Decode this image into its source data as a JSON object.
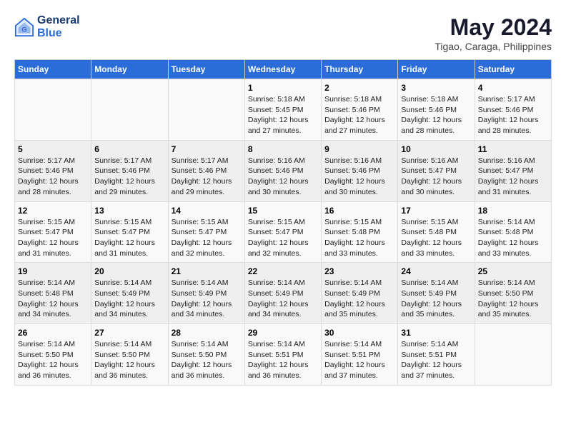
{
  "header": {
    "logo_line1": "General",
    "logo_line2": "Blue",
    "title": "May 2024",
    "subtitle": "Tigao, Caraga, Philippines"
  },
  "calendar": {
    "weekdays": [
      "Sunday",
      "Monday",
      "Tuesday",
      "Wednesday",
      "Thursday",
      "Friday",
      "Saturday"
    ],
    "weeks": [
      [
        {
          "day": "",
          "info": ""
        },
        {
          "day": "",
          "info": ""
        },
        {
          "day": "",
          "info": ""
        },
        {
          "day": "1",
          "info": "Sunrise: 5:18 AM\nSunset: 5:45 PM\nDaylight: 12 hours\nand 27 minutes."
        },
        {
          "day": "2",
          "info": "Sunrise: 5:18 AM\nSunset: 5:46 PM\nDaylight: 12 hours\nand 27 minutes."
        },
        {
          "day": "3",
          "info": "Sunrise: 5:18 AM\nSunset: 5:46 PM\nDaylight: 12 hours\nand 28 minutes."
        },
        {
          "day": "4",
          "info": "Sunrise: 5:17 AM\nSunset: 5:46 PM\nDaylight: 12 hours\nand 28 minutes."
        }
      ],
      [
        {
          "day": "5",
          "info": "Sunrise: 5:17 AM\nSunset: 5:46 PM\nDaylight: 12 hours\nand 28 minutes."
        },
        {
          "day": "6",
          "info": "Sunrise: 5:17 AM\nSunset: 5:46 PM\nDaylight: 12 hours\nand 29 minutes."
        },
        {
          "day": "7",
          "info": "Sunrise: 5:17 AM\nSunset: 5:46 PM\nDaylight: 12 hours\nand 29 minutes."
        },
        {
          "day": "8",
          "info": "Sunrise: 5:16 AM\nSunset: 5:46 PM\nDaylight: 12 hours\nand 30 minutes."
        },
        {
          "day": "9",
          "info": "Sunrise: 5:16 AM\nSunset: 5:46 PM\nDaylight: 12 hours\nand 30 minutes."
        },
        {
          "day": "10",
          "info": "Sunrise: 5:16 AM\nSunset: 5:47 PM\nDaylight: 12 hours\nand 30 minutes."
        },
        {
          "day": "11",
          "info": "Sunrise: 5:16 AM\nSunset: 5:47 PM\nDaylight: 12 hours\nand 31 minutes."
        }
      ],
      [
        {
          "day": "12",
          "info": "Sunrise: 5:15 AM\nSunset: 5:47 PM\nDaylight: 12 hours\nand 31 minutes."
        },
        {
          "day": "13",
          "info": "Sunrise: 5:15 AM\nSunset: 5:47 PM\nDaylight: 12 hours\nand 31 minutes."
        },
        {
          "day": "14",
          "info": "Sunrise: 5:15 AM\nSunset: 5:47 PM\nDaylight: 12 hours\nand 32 minutes."
        },
        {
          "day": "15",
          "info": "Sunrise: 5:15 AM\nSunset: 5:47 PM\nDaylight: 12 hours\nand 32 minutes."
        },
        {
          "day": "16",
          "info": "Sunrise: 5:15 AM\nSunset: 5:48 PM\nDaylight: 12 hours\nand 33 minutes."
        },
        {
          "day": "17",
          "info": "Sunrise: 5:15 AM\nSunset: 5:48 PM\nDaylight: 12 hours\nand 33 minutes."
        },
        {
          "day": "18",
          "info": "Sunrise: 5:14 AM\nSunset: 5:48 PM\nDaylight: 12 hours\nand 33 minutes."
        }
      ],
      [
        {
          "day": "19",
          "info": "Sunrise: 5:14 AM\nSunset: 5:48 PM\nDaylight: 12 hours\nand 34 minutes."
        },
        {
          "day": "20",
          "info": "Sunrise: 5:14 AM\nSunset: 5:49 PM\nDaylight: 12 hours\nand 34 minutes."
        },
        {
          "day": "21",
          "info": "Sunrise: 5:14 AM\nSunset: 5:49 PM\nDaylight: 12 hours\nand 34 minutes."
        },
        {
          "day": "22",
          "info": "Sunrise: 5:14 AM\nSunset: 5:49 PM\nDaylight: 12 hours\nand 34 minutes."
        },
        {
          "day": "23",
          "info": "Sunrise: 5:14 AM\nSunset: 5:49 PM\nDaylight: 12 hours\nand 35 minutes."
        },
        {
          "day": "24",
          "info": "Sunrise: 5:14 AM\nSunset: 5:49 PM\nDaylight: 12 hours\nand 35 minutes."
        },
        {
          "day": "25",
          "info": "Sunrise: 5:14 AM\nSunset: 5:50 PM\nDaylight: 12 hours\nand 35 minutes."
        }
      ],
      [
        {
          "day": "26",
          "info": "Sunrise: 5:14 AM\nSunset: 5:50 PM\nDaylight: 12 hours\nand 36 minutes."
        },
        {
          "day": "27",
          "info": "Sunrise: 5:14 AM\nSunset: 5:50 PM\nDaylight: 12 hours\nand 36 minutes."
        },
        {
          "day": "28",
          "info": "Sunrise: 5:14 AM\nSunset: 5:50 PM\nDaylight: 12 hours\nand 36 minutes."
        },
        {
          "day": "29",
          "info": "Sunrise: 5:14 AM\nSunset: 5:51 PM\nDaylight: 12 hours\nand 36 minutes."
        },
        {
          "day": "30",
          "info": "Sunrise: 5:14 AM\nSunset: 5:51 PM\nDaylight: 12 hours\nand 37 minutes."
        },
        {
          "day": "31",
          "info": "Sunrise: 5:14 AM\nSunset: 5:51 PM\nDaylight: 12 hours\nand 37 minutes."
        },
        {
          "day": "",
          "info": ""
        }
      ]
    ]
  }
}
